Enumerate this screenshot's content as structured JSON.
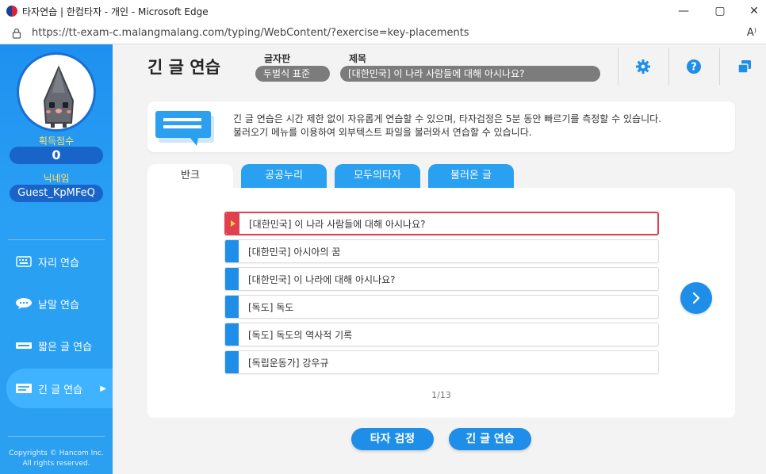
{
  "browser": {
    "window_title": "타자연습 | 한컴타자 - 개인 - Microsoft Edge",
    "url": "https://tt-exam-c.malangmalang.com/typing/WebContent/?exercise=key-placements",
    "read_aloud": "A⁾",
    "minimize": "—",
    "maximize": "▢",
    "close": "✕"
  },
  "sidebar": {
    "score_label": "획득점수",
    "score_value": "0",
    "nickname_label": "닉네임",
    "nickname": "Guest_KpMFeQ",
    "menu": [
      {
        "label": "자리 연습",
        "icon": "keyboard-icon"
      },
      {
        "label": "낱말 연습",
        "icon": "speech-bubble-icon"
      },
      {
        "label": "짧은 글 연습",
        "icon": "short-text-icon"
      },
      {
        "label": "긴 글 연습",
        "icon": "long-text-icon",
        "active": true
      }
    ],
    "copyright_line1": "Copyrights © Hancom Inc.",
    "copyright_line2": "All rights reserved."
  },
  "header": {
    "title": "긴 글 연습",
    "keyboard_label": "글자판",
    "keyboard_value": "두벌식 표준",
    "subject_label": "제목",
    "subject_value": "[대한민국] 이 나라 사람들에 대해 아시나요?",
    "icons": [
      "gear-icon",
      "help-icon",
      "window-icon"
    ]
  },
  "info": {
    "line1": "긴 글 연습은 시간 제한 없이 자유롭게 연습할 수 있으며, 타자검정은 5분 동안 빠르기를 측정할 수 있습니다.",
    "line2": "불러오기 메뉴를 이용하여 외부텍스트 파일을 불러와서 연습할 수 있습니다."
  },
  "tabs": [
    "반크",
    "공공누리",
    "모두의타자",
    "불러온 글"
  ],
  "active_tab": "반크",
  "list": [
    "[대한민국] 이 나라 사람들에 대해 아시나요?",
    "[대한민국] 아시아의 꿈",
    "[대한민국] 이 나라에 대해 아시나요?",
    "[독도] 독도",
    "[독도] 독도의 역사적 기록",
    "[독립운동가] 강우규"
  ],
  "selected_index": 0,
  "pager": "1/13",
  "buttons": {
    "typing_test": "타자 검정",
    "long_practice": "긴 글 연습"
  },
  "colors": {
    "accent": "#1f8ee8",
    "sidebar": "#2a9ff2",
    "selected_border": "#e04050"
  }
}
